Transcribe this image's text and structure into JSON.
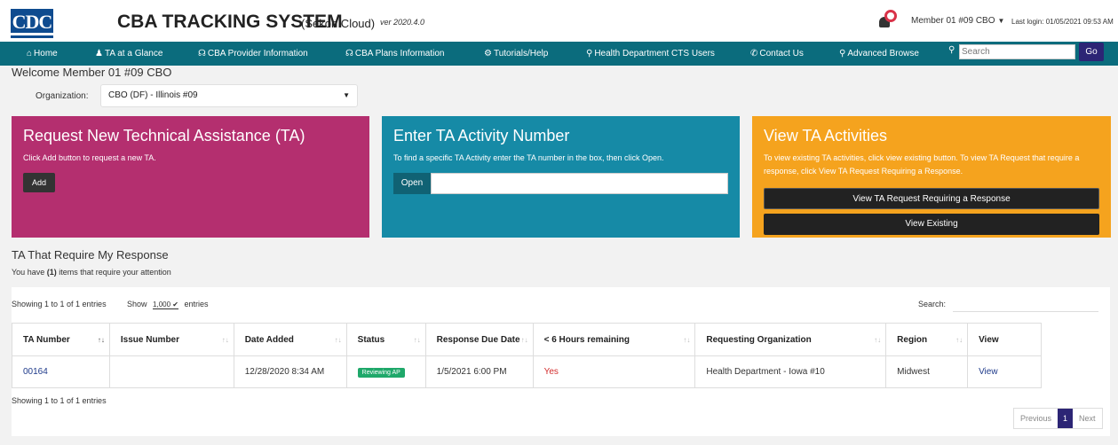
{
  "header": {
    "logo_text": "CDC",
    "title": "CBA TRACKING SYSTEM",
    "subtitle": "(Sekon Cloud)",
    "version": "ver 2020.4.0",
    "member": "Member 01 #09 CBO",
    "last_login": "Last login: 01/05/2021 09:53 AM"
  },
  "nav": {
    "items": [
      {
        "label": "Home",
        "icon": "home-icon"
      },
      {
        "label": "TA at a Glance",
        "icon": "users-icon"
      },
      {
        "label": "CBA Provider Information",
        "icon": "headset-icon"
      },
      {
        "label": "CBA Plans Information",
        "icon": "headset-icon"
      },
      {
        "label": "Tutorials/Help",
        "icon": "gear-icon"
      },
      {
        "label": "Health Department CTS Users",
        "icon": "location-icon"
      },
      {
        "label": "Contact Us",
        "icon": "phone-icon"
      },
      {
        "label": "Advanced Browse",
        "icon": "search-icon"
      }
    ],
    "search_placeholder": "Search",
    "go_label": "Go"
  },
  "welcome": "Welcome Member 01 #09 CBO",
  "organization": {
    "label": "Organization:",
    "value": "CBO (DF) - Illinois #09"
  },
  "cards": {
    "request": {
      "title": "Request New Technical Assistance (TA)",
      "text": "Click Add button to request a new TA.",
      "button": "Add",
      "color": "#b42f6f"
    },
    "enter": {
      "title": "Enter TA Activity Number",
      "text": "To find a specific TA Activity enter the TA number in the box, then click Open.",
      "button": "Open",
      "color": "#168aa6"
    },
    "view": {
      "title": "View TA Activities",
      "text": "To view existing TA activities, click view existing button. To view TA Request that require a response, click View TA Request Requiring a Response.",
      "button_requiring": "View TA Request Requiring a Response",
      "button_existing": "View Existing",
      "color": "#f5a31e"
    }
  },
  "section": {
    "title": "TA That Require My Response",
    "subtitle_pre": "You have ",
    "subtitle_count": "(1)",
    "subtitle_post": " items that require your attention"
  },
  "table": {
    "info_top": "Showing 1 to 1 of 1 entries",
    "show_label": "Show",
    "length_value": "1,000",
    "entries_label": "entries",
    "search_label": "Search:",
    "columns": [
      "TA Number",
      "Issue Number",
      "Date Added",
      "Status",
      "Response Due Date",
      "< 6 Hours remaining",
      "Requesting Organization",
      "Region",
      "View"
    ],
    "rows": [
      {
        "ta_number": "00164",
        "issue_number": "",
        "date_added": "12/28/2020 8:34 AM",
        "status": "Reviewing AP",
        "response_due": "1/5/2021 6:00 PM",
        "hours_remaining": "Yes",
        "requesting_org": "Health Department - Iowa #10",
        "region": "Midwest",
        "view": "View"
      }
    ],
    "info_bottom": "Showing 1 to 1 of 1 entries",
    "pager": {
      "previous": "Previous",
      "current": "1",
      "next": "Next"
    }
  }
}
